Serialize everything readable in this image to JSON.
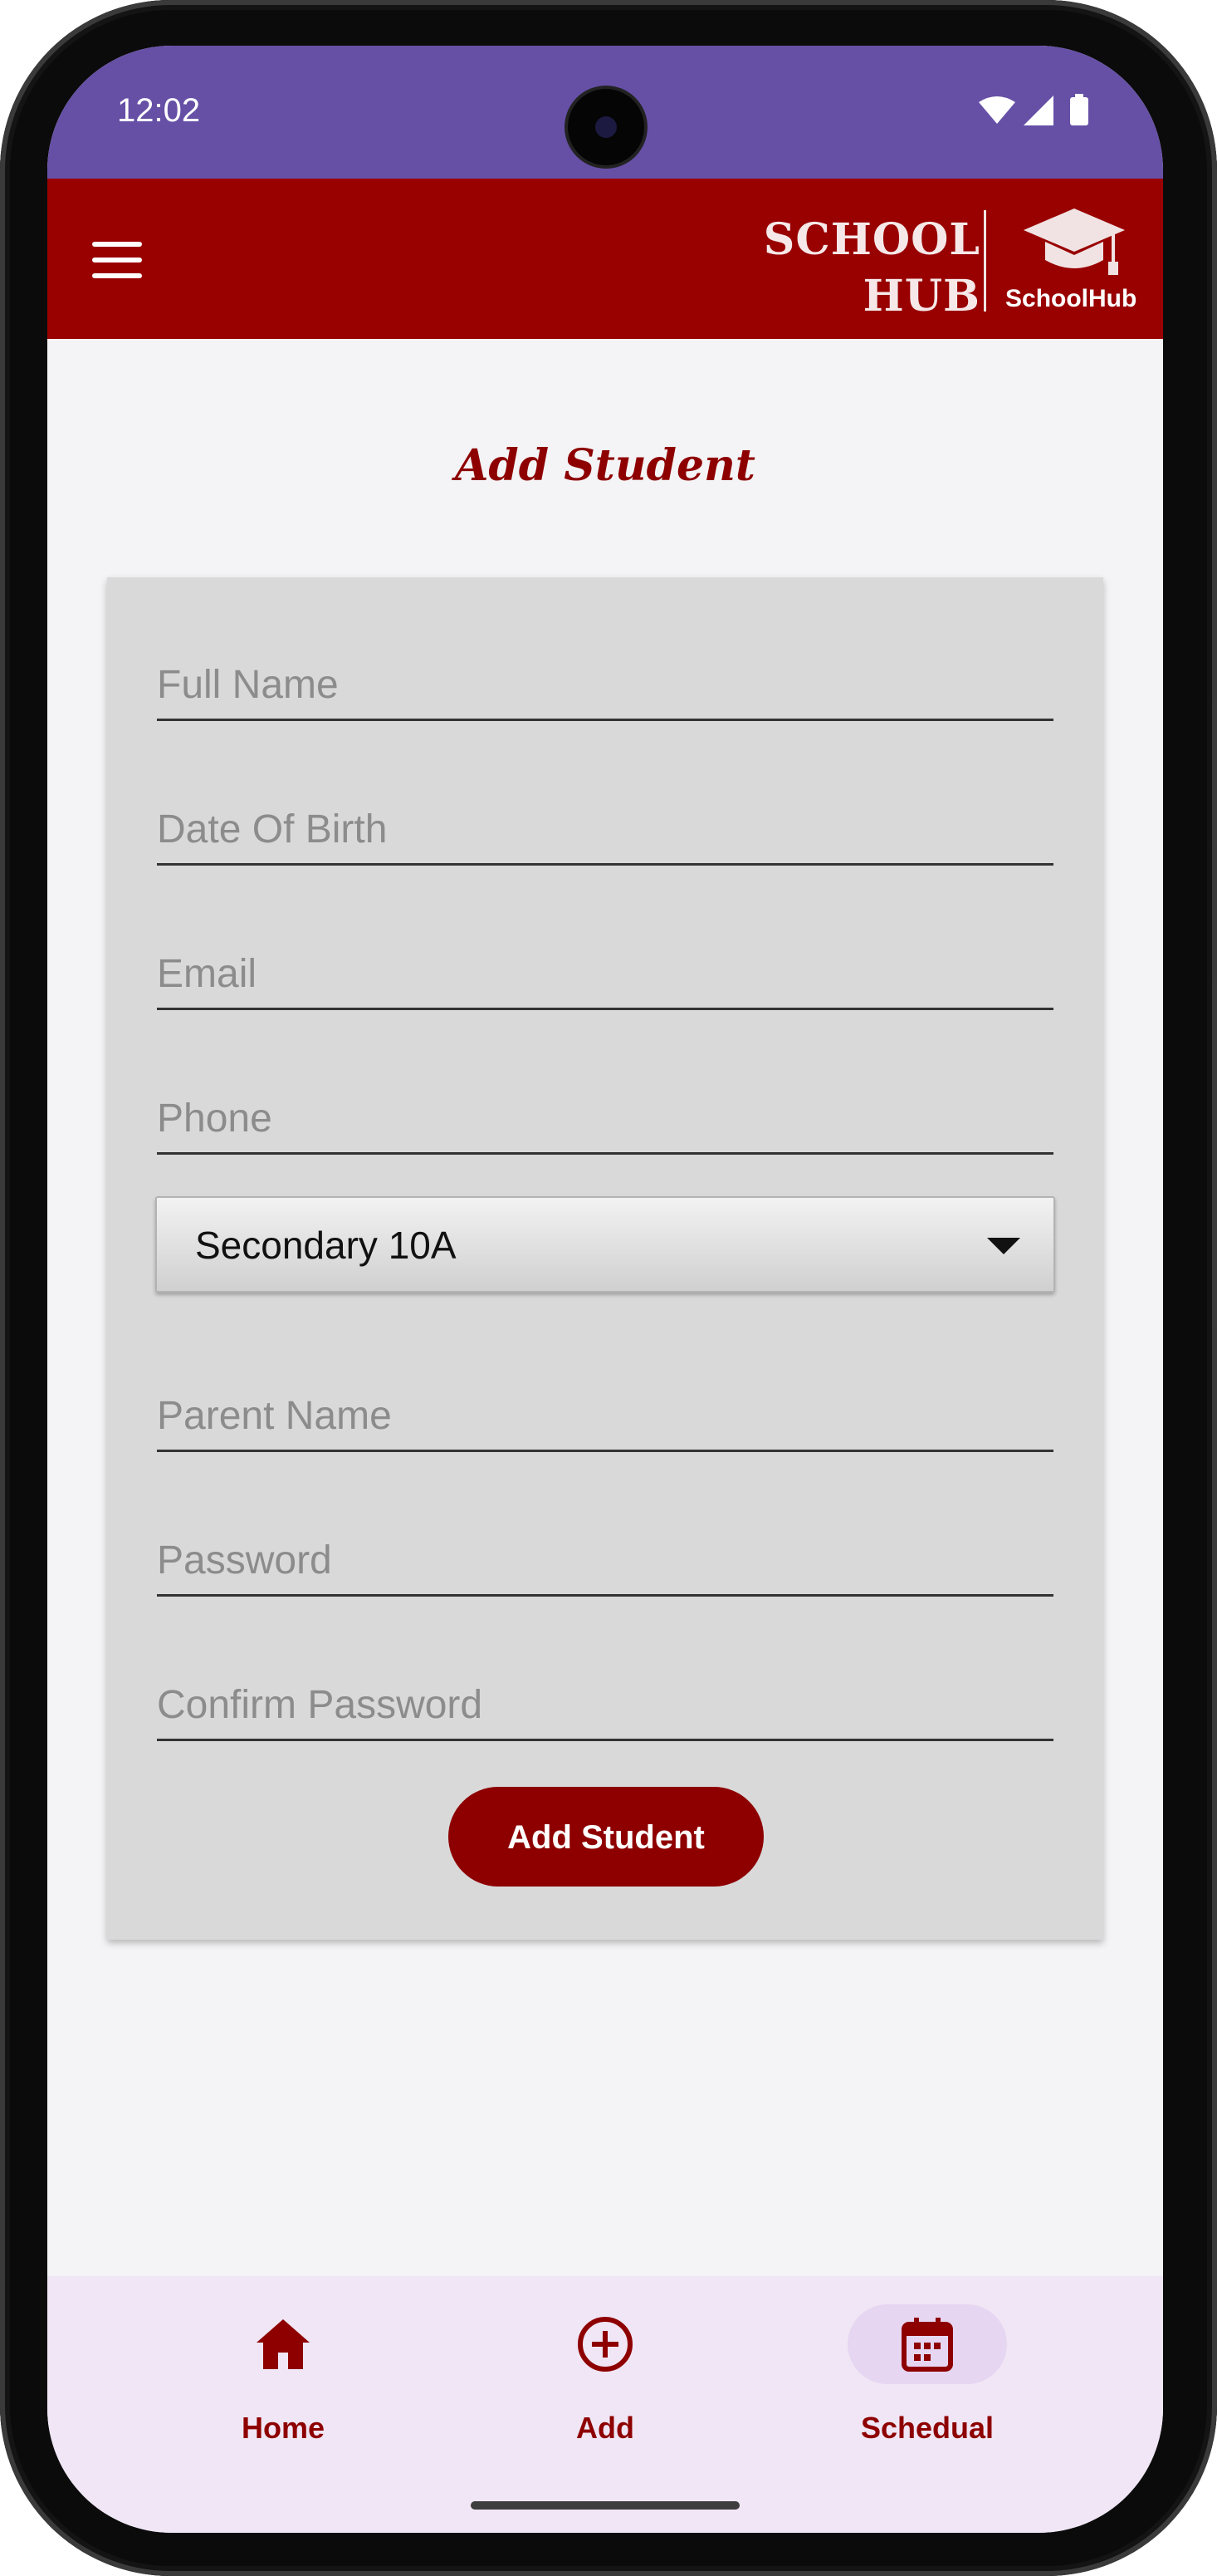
{
  "status_bar": {
    "time": "12:02"
  },
  "app_bar": {
    "brand_line1": "SCHOOL",
    "brand_line2": "HUB",
    "logo_text": "SchoolHub"
  },
  "page": {
    "title": "Add Student"
  },
  "form": {
    "fields": [
      {
        "placeholder": "Full Name",
        "value": ""
      },
      {
        "placeholder": "Date Of Birth",
        "value": ""
      },
      {
        "placeholder": "Email",
        "value": ""
      },
      {
        "placeholder": "Phone",
        "value": ""
      },
      {
        "placeholder": "Parent Name",
        "value": ""
      },
      {
        "placeholder": "Password",
        "value": ""
      },
      {
        "placeholder": "Confirm Password",
        "value": ""
      }
    ],
    "class_select": {
      "selected": "Secondary 10A"
    },
    "submit_label": "Add Student"
  },
  "bottom_nav": {
    "items": [
      {
        "label": "Home",
        "icon": "home-icon",
        "active": false
      },
      {
        "label": "Add",
        "icon": "add-circle-icon",
        "active": false
      },
      {
        "label": "Schedual",
        "icon": "calendar-icon",
        "active": true
      }
    ]
  },
  "colors": {
    "status_bar": "#6650a6",
    "app_bar": "#990000",
    "accent": "#8e0000",
    "card": "#d9d9d9",
    "nav_bg": "#f0e6f5",
    "nav_active_pill": "#e6d6f2"
  }
}
